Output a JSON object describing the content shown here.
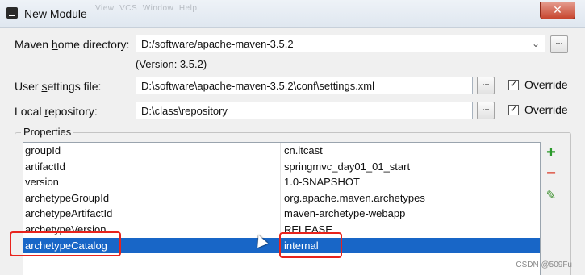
{
  "window": {
    "title": "New Module",
    "background_title": "IntelliJ IDEA",
    "close_glyph": "✕"
  },
  "background_menu": [
    "View",
    "VCS",
    "Window",
    "Help"
  ],
  "maven_home": {
    "label_pre": "Maven ",
    "label_u": "h",
    "label_post": "ome directory:",
    "value": "D:/software/apache-maven-3.5.2",
    "version": "(Version: 3.5.2)",
    "browse": "..."
  },
  "user_settings": {
    "label_pre": "User ",
    "label_u": "s",
    "label_post": "ettings file:",
    "value": "D:\\software\\apache-maven-3.5.2\\conf\\settings.xml",
    "browse": "...",
    "override_label": "Override",
    "override_checked": true
  },
  "local_repository": {
    "label_pre": "Local ",
    "label_u": "r",
    "label_post": "epository:",
    "value": "D:\\class\\repository",
    "browse": "...",
    "override_label": "Override",
    "override_checked": true
  },
  "properties": {
    "title": "Properties",
    "rows": [
      {
        "key": "groupId",
        "value": "cn.itcast"
      },
      {
        "key": "artifactId",
        "value": "springmvc_day01_01_start"
      },
      {
        "key": "version",
        "value": "1.0-SNAPSHOT"
      },
      {
        "key": "archetypeGroupId",
        "value": "org.apache.maven.archetypes"
      },
      {
        "key": "archetypeArtifactId",
        "value": "maven-archetype-webapp"
      },
      {
        "key": "archetypeVersion",
        "value": "RELEASE"
      },
      {
        "key": "archetypeCatalog",
        "value": "internal"
      }
    ],
    "selected_row": 6,
    "actions": {
      "add": "+",
      "remove": "−",
      "edit": "✎"
    },
    "accent_colors": {
      "selection": "#1866c7",
      "highlight_box": "#e8231c",
      "add": "#2b9a2b",
      "remove": "#d9331e",
      "edit": "#3a8f2c"
    }
  },
  "watermark": "CSDN @509Fu"
}
